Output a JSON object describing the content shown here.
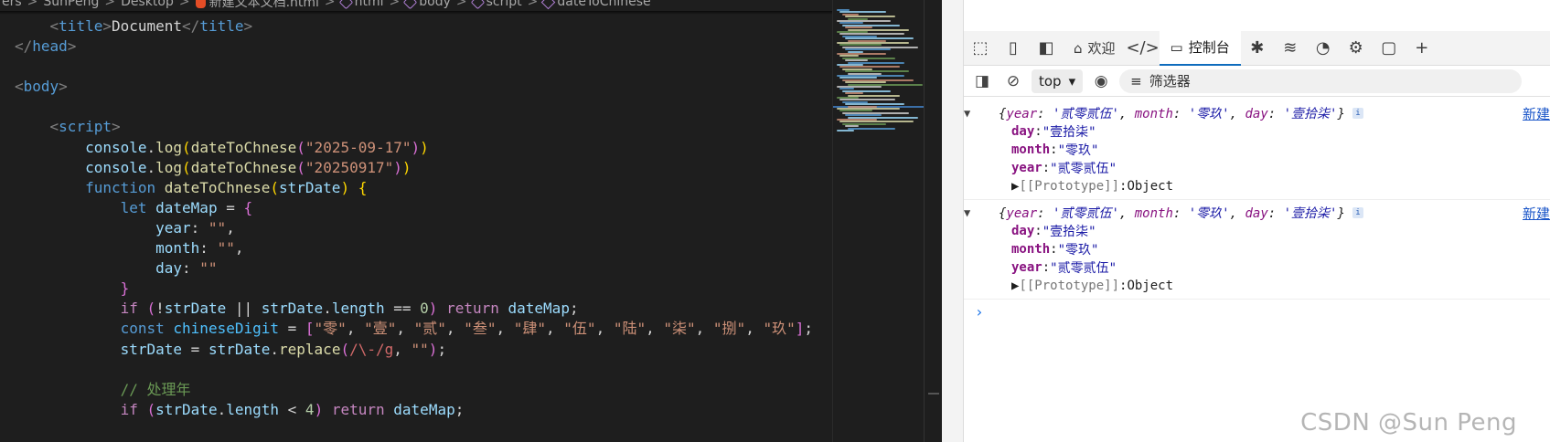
{
  "breadcrumb": {
    "items": [
      "ers",
      "SunPeng",
      "Desktop",
      "新建文本文档.html",
      "html",
      "body",
      "script",
      "dateToChinese"
    ],
    "separator": ">"
  },
  "code_lines": [
    [
      [
        "tk-txt",
        "    "
      ],
      [
        "tk-br",
        "<"
      ],
      [
        "tk-tag",
        "title"
      ],
      [
        "tk-br",
        ">"
      ],
      [
        "tk-txt",
        "Document"
      ],
      [
        "tk-br",
        "</"
      ],
      [
        "tk-tag",
        "title"
      ],
      [
        "tk-br",
        ">"
      ]
    ],
    [
      [
        "tk-br",
        "</"
      ],
      [
        "tk-tag",
        "head"
      ],
      [
        "tk-br",
        ">"
      ]
    ],
    [],
    [
      [
        "tk-br",
        "<"
      ],
      [
        "tk-tag",
        "body"
      ],
      [
        "tk-br",
        ">"
      ]
    ],
    [],
    [
      [
        "tk-txt",
        "    "
      ],
      [
        "tk-br",
        "<"
      ],
      [
        "tk-tag",
        "script"
      ],
      [
        "tk-br",
        ">"
      ]
    ],
    [
      [
        "tk-txt",
        "        "
      ],
      [
        "tk-var",
        "console"
      ],
      [
        "tk-txt",
        "."
      ],
      [
        "tk-fn",
        "log"
      ],
      [
        "tk-p1",
        "("
      ],
      [
        "tk-fn",
        "dateToChnese"
      ],
      [
        "tk-p2",
        "("
      ],
      [
        "tk-str",
        "\"2025-09-17\""
      ],
      [
        "tk-p2",
        ")"
      ],
      [
        "tk-p1",
        ")"
      ]
    ],
    [
      [
        "tk-txt",
        "        "
      ],
      [
        "tk-var",
        "console"
      ],
      [
        "tk-txt",
        "."
      ],
      [
        "tk-fn",
        "log"
      ],
      [
        "tk-p1",
        "("
      ],
      [
        "tk-fn",
        "dateToChnese"
      ],
      [
        "tk-p2",
        "("
      ],
      [
        "tk-str",
        "\"20250917\""
      ],
      [
        "tk-p2",
        ")"
      ],
      [
        "tk-p1",
        ")"
      ]
    ],
    [
      [
        "tk-txt",
        "        "
      ],
      [
        "tk-kw",
        "function"
      ],
      [
        "tk-txt",
        " "
      ],
      [
        "tk-fn",
        "dateToChnese"
      ],
      [
        "tk-p1",
        "("
      ],
      [
        "tk-var",
        "strDate"
      ],
      [
        "tk-p1",
        ")"
      ],
      [
        "tk-txt",
        " "
      ],
      [
        "tk-p1",
        "{"
      ]
    ],
    [
      [
        "tk-txt",
        "            "
      ],
      [
        "tk-kw",
        "let"
      ],
      [
        "tk-txt",
        " "
      ],
      [
        "tk-var",
        "dateMap"
      ],
      [
        "tk-txt",
        " = "
      ],
      [
        "tk-p2",
        "{"
      ]
    ],
    [
      [
        "tk-txt",
        "                "
      ],
      [
        "tk-var",
        "year"
      ],
      [
        "tk-txt",
        ": "
      ],
      [
        "tk-str",
        "\"\""
      ],
      [
        "tk-txt",
        ","
      ]
    ],
    [
      [
        "tk-txt",
        "                "
      ],
      [
        "tk-var",
        "month"
      ],
      [
        "tk-txt",
        ": "
      ],
      [
        "tk-str",
        "\"\""
      ],
      [
        "tk-txt",
        ","
      ]
    ],
    [
      [
        "tk-txt",
        "                "
      ],
      [
        "tk-var",
        "day"
      ],
      [
        "tk-txt",
        ": "
      ],
      [
        "tk-str",
        "\"\""
      ]
    ],
    [
      [
        "tk-txt",
        "            "
      ],
      [
        "tk-p2",
        "}"
      ]
    ],
    [
      [
        "tk-txt",
        "            "
      ],
      [
        "tk-ctl",
        "if"
      ],
      [
        "tk-txt",
        " "
      ],
      [
        "tk-p2",
        "("
      ],
      [
        "tk-txt",
        "!"
      ],
      [
        "tk-var",
        "strDate"
      ],
      [
        "tk-txt",
        " || "
      ],
      [
        "tk-var",
        "strDate"
      ],
      [
        "tk-txt",
        "."
      ],
      [
        "tk-var",
        "length"
      ],
      [
        "tk-txt",
        " == "
      ],
      [
        "tk-num",
        "0"
      ],
      [
        "tk-p2",
        ")"
      ],
      [
        "tk-txt",
        " "
      ],
      [
        "tk-ctl",
        "return"
      ],
      [
        "tk-txt",
        " "
      ],
      [
        "tk-var",
        "dateMap"
      ],
      [
        "tk-txt",
        ";"
      ]
    ],
    [
      [
        "tk-txt",
        "            "
      ],
      [
        "tk-kw",
        "const"
      ],
      [
        "tk-txt",
        " "
      ],
      [
        "tk-const",
        "chineseDigit"
      ],
      [
        "tk-txt",
        " = "
      ],
      [
        "tk-p2",
        "["
      ],
      [
        "tk-str",
        "\"零\""
      ],
      [
        "tk-txt",
        ", "
      ],
      [
        "tk-str",
        "\"壹\""
      ],
      [
        "tk-txt",
        ", "
      ],
      [
        "tk-str",
        "\"贰\""
      ],
      [
        "tk-txt",
        ", "
      ],
      [
        "tk-str",
        "\"叁\""
      ],
      [
        "tk-txt",
        ", "
      ],
      [
        "tk-str",
        "\"肆\""
      ],
      [
        "tk-txt",
        ", "
      ],
      [
        "tk-str",
        "\"伍\""
      ],
      [
        "tk-txt",
        ", "
      ],
      [
        "tk-str",
        "\"陆\""
      ],
      [
        "tk-txt",
        ", "
      ],
      [
        "tk-str",
        "\"柒\""
      ],
      [
        "tk-txt",
        ", "
      ],
      [
        "tk-str",
        "\"捌\""
      ],
      [
        "tk-txt",
        ", "
      ],
      [
        "tk-str",
        "\"玖\""
      ],
      [
        "tk-p2",
        "]"
      ],
      [
        "tk-txt",
        ";"
      ]
    ],
    [
      [
        "tk-txt",
        "            "
      ],
      [
        "tk-var",
        "strDate"
      ],
      [
        "tk-txt",
        " = "
      ],
      [
        "tk-var",
        "strDate"
      ],
      [
        "tk-txt",
        "."
      ],
      [
        "tk-fn",
        "replace"
      ],
      [
        "tk-p2",
        "("
      ],
      [
        "tk-rx",
        "/\\-/g"
      ],
      [
        "tk-txt",
        ", "
      ],
      [
        "tk-str",
        "\"\""
      ],
      [
        "tk-p2",
        ")"
      ],
      [
        "tk-txt",
        ";"
      ]
    ],
    [],
    [
      [
        "tk-txt",
        "            "
      ],
      [
        "tk-cmt",
        "// 处理年"
      ]
    ],
    [
      [
        "tk-txt",
        "            "
      ],
      [
        "tk-ctl",
        "if"
      ],
      [
        "tk-txt",
        " "
      ],
      [
        "tk-p2",
        "("
      ],
      [
        "tk-var",
        "strDate"
      ],
      [
        "tk-txt",
        "."
      ],
      [
        "tk-var",
        "length"
      ],
      [
        "tk-txt",
        " < "
      ],
      [
        "tk-num",
        "4"
      ],
      [
        "tk-p2",
        ")"
      ],
      [
        "tk-txt",
        " "
      ],
      [
        "tk-ctl",
        "return"
      ],
      [
        "tk-txt",
        " "
      ],
      [
        "tk-var",
        "dateMap"
      ],
      [
        "tk-txt",
        ";"
      ]
    ]
  ],
  "devtools": {
    "tabs": [
      {
        "icon": "inspect-icon",
        "glyph": "⬚"
      },
      {
        "icon": "device-icon",
        "glyph": "▯"
      },
      {
        "icon": "panel-icon",
        "glyph": "◧"
      },
      {
        "icon": "home-icon",
        "glyph": "⌂",
        "label": "欢迎"
      },
      {
        "icon": "elements-icon",
        "glyph": "</>"
      },
      {
        "icon": "console-icon",
        "glyph": "▭",
        "label": "控制台",
        "active": true
      },
      {
        "icon": "bug-icon",
        "glyph": "✱"
      },
      {
        "icon": "network-icon",
        "glyph": "≋"
      },
      {
        "icon": "performance-icon",
        "glyph": "◔"
      },
      {
        "icon": "cpu-icon",
        "glyph": "⚙"
      },
      {
        "icon": "application-icon",
        "glyph": "▢"
      },
      {
        "icon": "add-icon",
        "glyph": "+"
      }
    ],
    "context": "top",
    "filter_placeholder": "筛选器",
    "entries": [
      {
        "summary": [
          "{",
          "year",
          ": ",
          "'贰零贰伍'",
          ", ",
          "month",
          ": ",
          "'零玖'",
          ", ",
          "day",
          ": ",
          "'壹拾柒'",
          "}"
        ],
        "source": "新建",
        "props": [
          [
            "day",
            "\"壹拾柒\""
          ],
          [
            "month",
            "\"零玖\""
          ],
          [
            "year",
            "\"贰零贰伍\""
          ]
        ],
        "proto": "[[Prototype]]",
        "proto_val": "Object"
      },
      {
        "summary": [
          "{",
          "year",
          ": ",
          "'贰零贰伍'",
          ", ",
          "month",
          ": ",
          "'零玖'",
          ", ",
          "day",
          ": ",
          "'壹拾柒'",
          "}"
        ],
        "source": "新建",
        "props": [
          [
            "day",
            "\"壹拾柒\""
          ],
          [
            "month",
            "\"零玖\""
          ],
          [
            "year",
            "\"贰零贰伍\""
          ]
        ],
        "proto": "[[Prototype]]",
        "proto_val": "Object"
      }
    ],
    "prompt": "›"
  },
  "watermark": "CSDN @Sun  Peng"
}
